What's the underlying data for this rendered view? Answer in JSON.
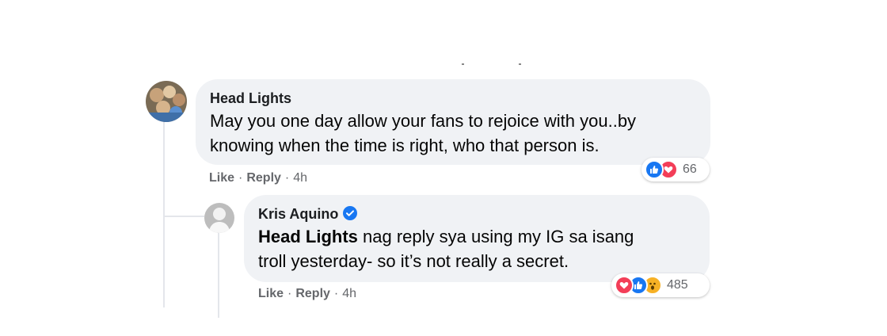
{
  "colors": {
    "bubble": "#f0f2f5",
    "meta_text": "#65676b",
    "like_blue": "#1877f2",
    "love_red": "#f33e58",
    "wow_yellow": "#f7b125",
    "verified_blue": "#1877f2"
  },
  "comment": {
    "author": "Head Lights",
    "text_line1": "May you one day allow your fans to rejoice with you..by",
    "text_line2": "knowing when the time is right, who that person is.",
    "actions": {
      "like": "Like",
      "reply": "Reply",
      "time": "4h",
      "dot": "·"
    },
    "reactions": {
      "icons": [
        "like-icon",
        "love-icon"
      ],
      "count": "66"
    }
  },
  "reply": {
    "author": "Kris Aquino",
    "verified_icon": "verified-badge-icon",
    "mention": "Head Lights",
    "text_line1_rest": " nag reply sya using my IG sa isang",
    "text_line2": "troll yesterday- so it’s not really a secret.",
    "actions": {
      "like": "Like",
      "reply": "Reply",
      "time": "4h",
      "dot": "·"
    },
    "reactions": {
      "icons": [
        "love-icon",
        "like-icon",
        "wow-icon"
      ],
      "count": "485"
    }
  }
}
